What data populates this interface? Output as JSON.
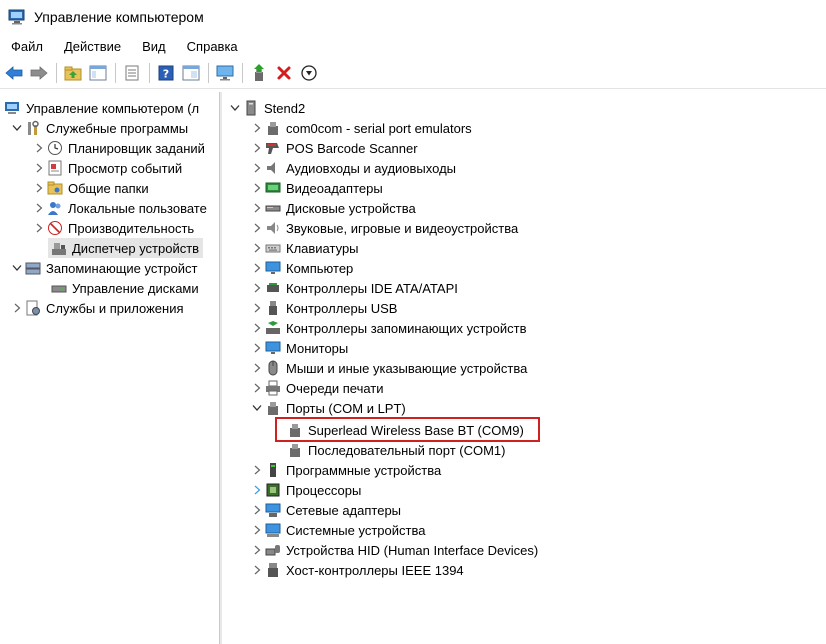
{
  "window": {
    "title": "Управление компьютером"
  },
  "menu": [
    "Файл",
    "Действие",
    "Вид",
    "Справка"
  ],
  "toolbar": [
    "back-icon",
    "forward-icon",
    "up-folder-icon",
    "show-tree-icon",
    "export-list-icon",
    "help-icon",
    "properties-icon",
    "monitor-icon",
    "update-driver-icon",
    "uninstall-icon",
    "disable-icon"
  ],
  "left_tree": {
    "root": "Управление компьютером (л",
    "items": [
      {
        "label": "Служебные программы"
      },
      {
        "label": "Планировщик заданий"
      },
      {
        "label": "Просмотр событий"
      },
      {
        "label": "Общие папки"
      },
      {
        "label": "Локальные пользовате"
      },
      {
        "label": "Производительность"
      },
      {
        "label": "Диспетчер устройств"
      },
      {
        "label": "Запоминающие устройст"
      },
      {
        "label": "Управление дисками"
      },
      {
        "label": "Службы и приложения"
      }
    ]
  },
  "device_tree": {
    "root": "Stend2",
    "categories": [
      "com0com - serial port emulators",
      "POS Barcode Scanner",
      "Аудиовходы и аудиовыходы",
      "Видеоадаптеры",
      "Дисковые устройства",
      "Звуковые, игровые и видеоустройства",
      "Клавиатуры",
      "Компьютер",
      "Контроллеры IDE ATA/ATAPI",
      "Контроллеры USB",
      "Контроллеры запоминающих устройств",
      "Мониторы",
      "Мыши и иные указывающие устройства",
      "Очереди печати",
      "Порты (COM и LPT)",
      "Superlead Wireless Base BT (COM9)",
      "Последовательный порт (COM1)",
      "Программные устройства",
      "Процессоры",
      "Сетевые адаптеры",
      "Системные устройства",
      "Устройства HID (Human Interface Devices)",
      "Хост-контроллеры IEEE 1394"
    ]
  }
}
